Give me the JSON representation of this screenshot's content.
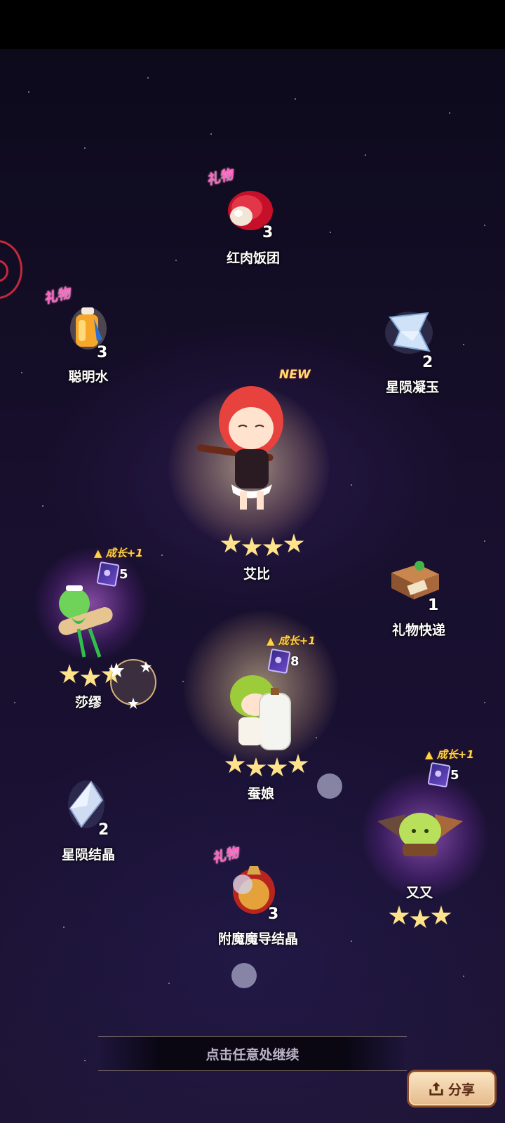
{
  "items": [
    {
      "name": "红肉饭团",
      "count": "3",
      "gift": "礼物"
    },
    {
      "name": "聪明水",
      "count": "3",
      "gift": "礼物"
    },
    {
      "name": "星陨凝玉",
      "count": "2"
    },
    {
      "name": "礼物快递",
      "count": "1"
    },
    {
      "name": "星陨结晶",
      "count": "2"
    },
    {
      "name": "附魔魔导结晶",
      "count": "3",
      "gift": "礼物"
    }
  ],
  "characters": [
    {
      "name": "艾比",
      "stars": 4,
      "new_tag": "NEW"
    },
    {
      "name": "莎缪",
      "stars": 3,
      "growth": "成长+1",
      "cards": "5"
    },
    {
      "name": "蚕娘",
      "stars": 4,
      "growth": "成长+1",
      "cards": "8"
    },
    {
      "name": "又又",
      "stars": 3,
      "growth": "成长+1",
      "cards": "5"
    }
  ],
  "continue_text": "点击任意处继续",
  "share_label": "分享",
  "colors": {
    "gift_pink": "#ff5fc0",
    "star_gold": "#ffe38a",
    "growth_gold": "#ffd24a",
    "ring_red": "#c22a3a"
  }
}
